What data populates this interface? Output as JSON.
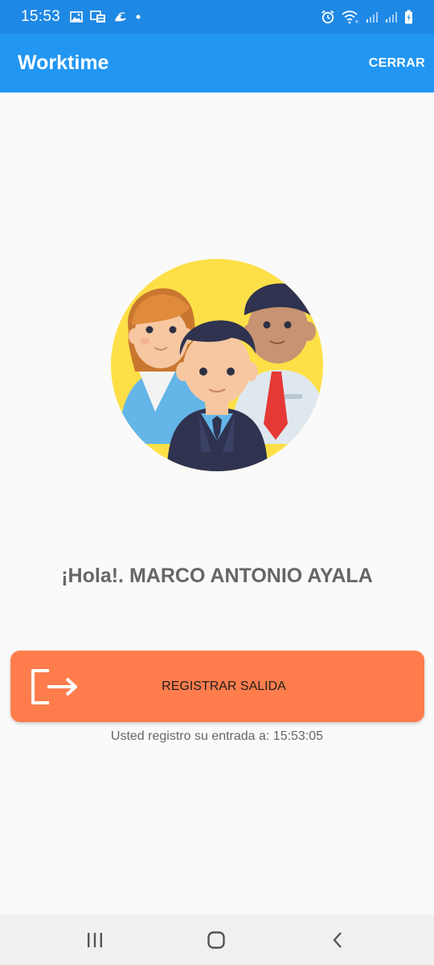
{
  "status_bar": {
    "time": "15:53",
    "left_icons": [
      "gallery-icon",
      "cast-icon",
      "wave-icon",
      "dot-icon"
    ],
    "right_icons": [
      "alarm-icon",
      "wifi-icon",
      "signal-icon",
      "signal-icon",
      "battery-charging-icon"
    ]
  },
  "app_bar": {
    "title": "Worktime",
    "close_label": "CERRAR"
  },
  "main": {
    "illustration": "team-avatars-illustration",
    "greeting": "¡Hola!. MARCO ANTONIO AYALA",
    "register_button": {
      "icon": "exit-icon",
      "label": "REGISTRAR SALIDA"
    },
    "entry_text": "Usted registro su entrada a: 15:53:05"
  },
  "nav_bar": {
    "buttons": [
      "recent-apps-icon",
      "home-icon",
      "back-icon"
    ]
  },
  "colors": {
    "status_bar": "#1e88e5",
    "app_bar": "#2196f3",
    "button": "#ff7d4d",
    "background": "#fafafa",
    "text_gray": "#666666"
  }
}
